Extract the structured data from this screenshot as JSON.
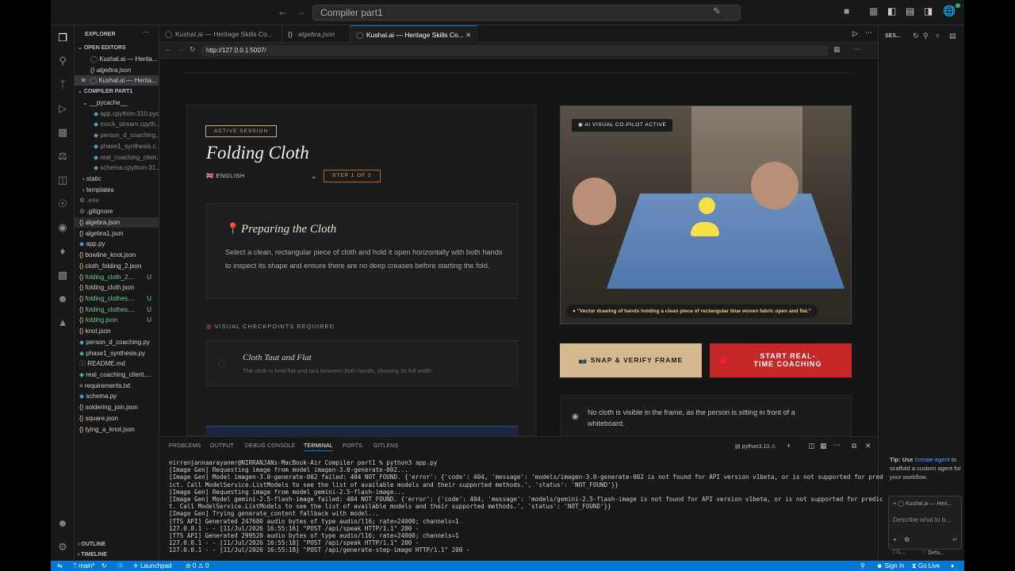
{
  "window": {
    "command_center": "Compiler part1"
  },
  "explorer": {
    "title": "EXPLORER",
    "open_editors_title": "OPEN EDITORS",
    "open_editors": [
      "Kushal.ai — Herita...",
      "algebra.json",
      "Kushal.ai — Herita..."
    ],
    "project_title": "COMPILER PART1",
    "files": [
      {
        "name": "__pycache__",
        "color": "#cccccc",
        "badge": ""
      },
      {
        "name": "app.cpython-310.pyc",
        "color": "#8a8a8a",
        "badge": ""
      },
      {
        "name": "mock_stream.cpyth...",
        "color": "#8a8a8a",
        "badge": ""
      },
      {
        "name": "person_d_coaching...",
        "color": "#8a8a8a",
        "badge": ""
      },
      {
        "name": "phase1_synthesis.c...",
        "color": "#8a8a8a",
        "badge": ""
      },
      {
        "name": "real_coaching_clien...",
        "color": "#8a8a8a",
        "badge": ""
      },
      {
        "name": "schema.cpython-31...",
        "color": "#8a8a8a",
        "badge": ""
      },
      {
        "name": "static",
        "color": "#cccccc",
        "badge": ""
      },
      {
        "name": "templates",
        "color": "#cccccc",
        "badge": ""
      },
      {
        "name": ".env",
        "color": "#8a8a8a",
        "badge": ""
      },
      {
        "name": ".gitignore",
        "color": "#cccccc",
        "badge": ""
      },
      {
        "name": "algebra.json",
        "color": "#cccccc",
        "badge": ""
      },
      {
        "name": "algebra1.json",
        "color": "#cccccc",
        "badge": ""
      },
      {
        "name": "app.py",
        "color": "#cccccc",
        "badge": ""
      },
      {
        "name": "bowline_knot.json",
        "color": "#cccccc",
        "badge": ""
      },
      {
        "name": "cloth_folding_2.json",
        "color": "#cccccc",
        "badge": ""
      },
      {
        "name": "folding_cloth_2....",
        "color": "#73c991",
        "badge": "U"
      },
      {
        "name": "folding_cloth.json",
        "color": "#cccccc",
        "badge": ""
      },
      {
        "name": "folding_clothes....",
        "color": "#73c991",
        "badge": "U"
      },
      {
        "name": "folding_clothes....",
        "color": "#73c991",
        "badge": "U"
      },
      {
        "name": "folding.json",
        "color": "#73c991",
        "badge": "U"
      },
      {
        "name": "knot.json",
        "color": "#cccccc",
        "badge": ""
      },
      {
        "name": "person_d_coaching.py",
        "color": "#cccccc",
        "badge": ""
      },
      {
        "name": "phase1_synthesis.py",
        "color": "#cccccc",
        "badge": ""
      },
      {
        "name": "README.md",
        "color": "#cccccc",
        "badge": ""
      },
      {
        "name": "real_coaching_client....",
        "color": "#cccccc",
        "badge": ""
      },
      {
        "name": "requirements.txt",
        "color": "#cccccc",
        "badge": ""
      },
      {
        "name": "schema.py",
        "color": "#cccccc",
        "badge": ""
      },
      {
        "name": "soldering_join.json",
        "color": "#cccccc",
        "badge": ""
      },
      {
        "name": "square.json",
        "color": "#cccccc",
        "badge": ""
      },
      {
        "name": "tying_a_knot.json",
        "color": "#cccccc",
        "badge": ""
      }
    ],
    "outline": "OUTLINE",
    "timeline": "TIMELINE"
  },
  "tabs": [
    "Kushal.ai — Heritage Skills Co...",
    "algebra.json",
    "Kushal.ai — Heritage Skills Co..."
  ],
  "browser": {
    "url": "http://127.0.0.1:5007/"
  },
  "app": {
    "session_badge": "ACTIVE SESSION",
    "task_title": "Folding Cloth",
    "language": "🇬🇧 ENGLISH",
    "step": "STEP 1 OF 2",
    "step_title": "Preparing the Cloth",
    "step_desc": "Select a clean, rectangular piece of cloth and hold it open horizontally with both hands to inspect its shape and ensure there are no deep creases before starting the fold.",
    "checkpoints_label": "VISUAL CHECKPOINTS REQUIRED",
    "checkpoint_title": "Cloth Taut and Flat",
    "checkpoint_desc": "The cloth is held flat and taut between both hands, showing its full width.",
    "copilot_badge": "AI VISUAL CO-PILOT ACTIVE",
    "caption": "\"Vector drawing of hands holding a clean piece of rectangular blue woven fabric open and flat.\"",
    "snap_button": "📷 SNAP & VERIFY FRAME",
    "start_button_line1": "START REAL-",
    "start_button_line2": "TIME COACHING",
    "feedback": "No cloth is visible in the frame, as the person is sitting in front of a whiteboard."
  },
  "panel": {
    "tabs": [
      "PROBLEMS",
      "OUTPUT",
      "DEBUG CONSOLE",
      "TERMINAL",
      "PORTS",
      "GITLENS"
    ],
    "shell": "python3.10",
    "lines": [
      "nirranjannaarayanmr@NIRRANJANs-MacBook-Air Compiler part1 % python3 app.py",
      "[Image Gen] Requesting image from model imagen-3.0-generate-002...",
      "[Image Gen] Model imagen-3.0-generate-002 failed: 404 NOT_FOUND. {'error': {'code': 404, 'message': 'models/imagen-3.0-generate-002 is not found for API version v1beta, or is not supported for pred",
      "ict. Call ModelService.ListModels to see the list of available models and their supported methods.', 'status': 'NOT_FOUND'}}",
      "[Image Gen] Requesting image from model gemini-2.5-flash-image...",
      "[Image Gen] Model gemini-2.5-flash-image failed: 404 NOT_FOUND. {'error': {'code': 404, 'message': 'models/gemini-2.5-flash-image is not found for API version v1beta, or is not supported for predic",
      "t. Call ModelService.ListModels to see the list of available models and their supported methods.', 'status': 'NOT_FOUND'}}",
      "[Image Gen] Trying generate_content fallback with model...",
      "[TTS API] Generated 247680 audio bytes of type audio/l16; rate=24000; channels=1",
      "127.0.0.1 - - [11/Jul/2026 16:55:16] \"POST /api/speak HTTP/1.1\" 200 -",
      "[TTS API] Generated 299520 audio bytes of type audio/l16; rate=24000; channels=1",
      "127.0.0.1 - - [11/Jul/2026 16:55:18] \"POST /api/speak HTTP/1.1\" 200 -",
      "127.0.0.1 - - [11/Jul/2026 16:55:18] \"POST /api/generate-step-image HTTP/1.1\" 200 -"
    ]
  },
  "chat": {
    "header": "SES...",
    "tip_prefix": "Tip: Use ",
    "tip_link1": "/create-agent",
    "tip_rest": " to scaffold a custom agent for your workflow.",
    "context_chip": "Kushal.ai — Heri...",
    "input_placeholder": "Describe what to b...",
    "footer_left": "L...",
    "footer_right": "Defa..."
  },
  "status": {
    "branch": "main*",
    "launchpad": "Launchpad",
    "problems": "⊘ 0 ⚠ 0",
    "sign_in": "Sign In",
    "go_live": "Go Live"
  }
}
